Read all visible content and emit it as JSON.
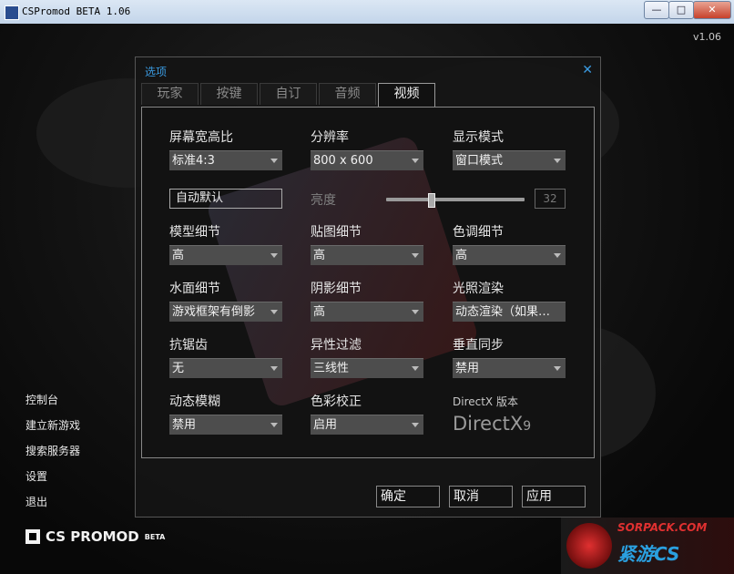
{
  "window": {
    "title": "CSPromod BETA 1.06",
    "minimize": "—",
    "maximize": "□",
    "close": "✕"
  },
  "version": "v1.06",
  "menu": [
    "控制台",
    "建立新游戏",
    "搜索服务器",
    "设置",
    "退出"
  ],
  "brand": {
    "name": "CS PROMOD",
    "tag": "BETA"
  },
  "watermark": {
    "top": "SORPACK.COM",
    "bottom": "紧游CS"
  },
  "dialog": {
    "title": "选项",
    "close": "✕",
    "tabs": [
      "玩家",
      "按键",
      "自订",
      "音频",
      "视频"
    ],
    "active_tab": "视频",
    "aspect_label": "屏幕宽高比",
    "aspect_value": "标准4:3",
    "resolution_label": "分辨率",
    "resolution_value": "800 x 600",
    "display_label": "显示模式",
    "display_value": "窗口模式",
    "auto_default": "自动默认",
    "brightness_label": "亮度",
    "brightness_value": "32",
    "brightness_fraction": 0.32,
    "model_label": "模型细节",
    "model_value": "高",
    "texture_label": "贴图细节",
    "texture_value": "高",
    "shader_label": "色调细节",
    "shader_value": "高",
    "water_label": "水面细节",
    "water_value": "游戏框架有倒影",
    "shadow_label": "阴影细节",
    "shadow_value": "高",
    "lighting_label": "光照渲染",
    "lighting_value": "动态渲染（如果…",
    "aa_label": "抗锯齿",
    "aa_value": "无",
    "aniso_label": "异性过滤",
    "aniso_value": "三线性",
    "vsync_label": "垂直同步",
    "vsync_value": "禁用",
    "motionblur_label": "动态模糊",
    "motionblur_value": "禁用",
    "colorcorr_label": "色彩校正",
    "colorcorr_value": "启用",
    "directx_label": "DirectX 版本",
    "directx_logo": "DirectX",
    "directx_ver": "9",
    "ok": "确定",
    "cancel": "取消",
    "apply": "应用"
  }
}
